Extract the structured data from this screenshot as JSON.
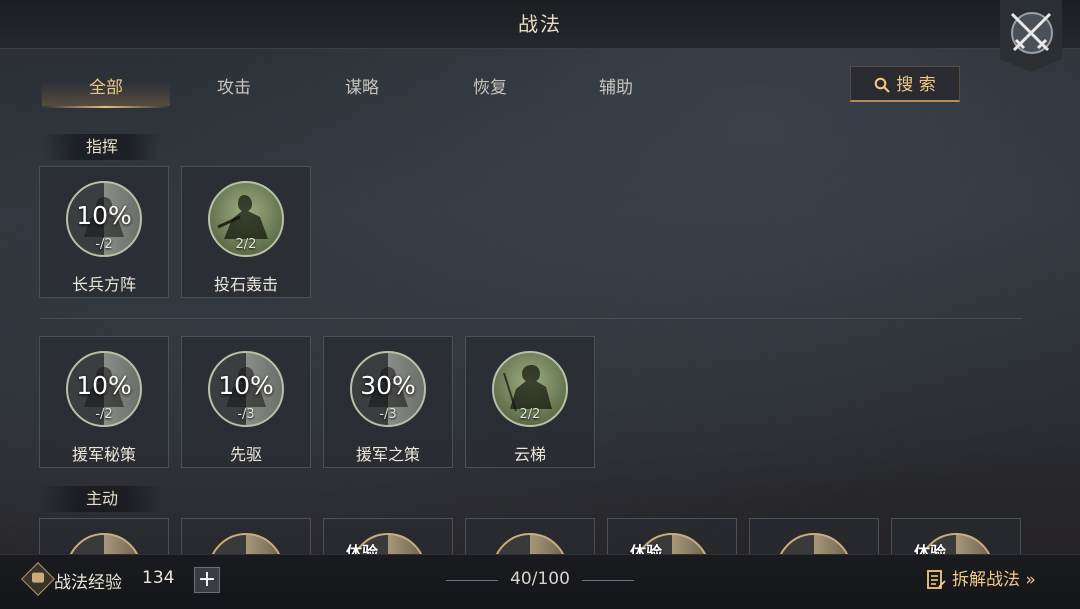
{
  "header": {
    "title": "战法"
  },
  "tabs": [
    {
      "label": "全部",
      "active": true
    },
    {
      "label": "攻击",
      "active": false
    },
    {
      "label": "谋略",
      "active": false
    },
    {
      "label": "恢复",
      "active": false
    },
    {
      "label": "辅助",
      "active": false
    }
  ],
  "search": {
    "label": "搜 索",
    "icon": "search-icon"
  },
  "sections": {
    "command": {
      "label": "指挥"
    },
    "active": {
      "label": "主动"
    }
  },
  "row1": [
    {
      "name": "长兵方阵",
      "progress": "10%",
      "level": "-/2"
    },
    {
      "name": "投石轰击",
      "level": "2/2"
    }
  ],
  "row2": [
    {
      "name": "援军秘策",
      "progress": "10%",
      "level": "-/2"
    },
    {
      "name": "先驱",
      "progress": "10%",
      "level": "-/3"
    },
    {
      "name": "援军之策",
      "progress": "30%",
      "level": "-/3"
    },
    {
      "name": "云梯",
      "level": "2/2"
    }
  ],
  "row3_trial_label": "体验",
  "footer": {
    "exp_label": "战法经验",
    "exp_value": "134",
    "add_label": "+",
    "count": "40/100",
    "disassemble_label": "拆解战法 »"
  },
  "colors": {
    "accent": "#f1c886",
    "text": "#ece6da"
  }
}
